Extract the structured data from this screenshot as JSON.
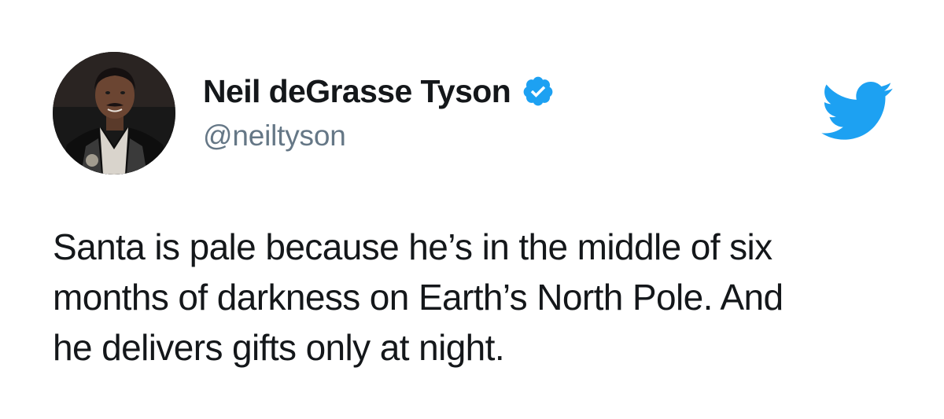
{
  "author": {
    "display_name": "Neil deGrasse Tyson",
    "handle": "@neiltyson",
    "verified": true
  },
  "tweet": {
    "lines": [
      "Santa is pale because he’s in the middle of six",
      "months of darkness on Earth’s North Pole. And",
      "he delivers gifts only at night."
    ]
  },
  "icons": {
    "verified": "verified-badge-icon",
    "brand": "twitter-bird-icon",
    "avatar": "profile-photo"
  },
  "colors": {
    "brand_blue": "#1DA1F2",
    "text_primary": "#14171A",
    "text_secondary": "#657786",
    "background": "#FFFFFF"
  }
}
